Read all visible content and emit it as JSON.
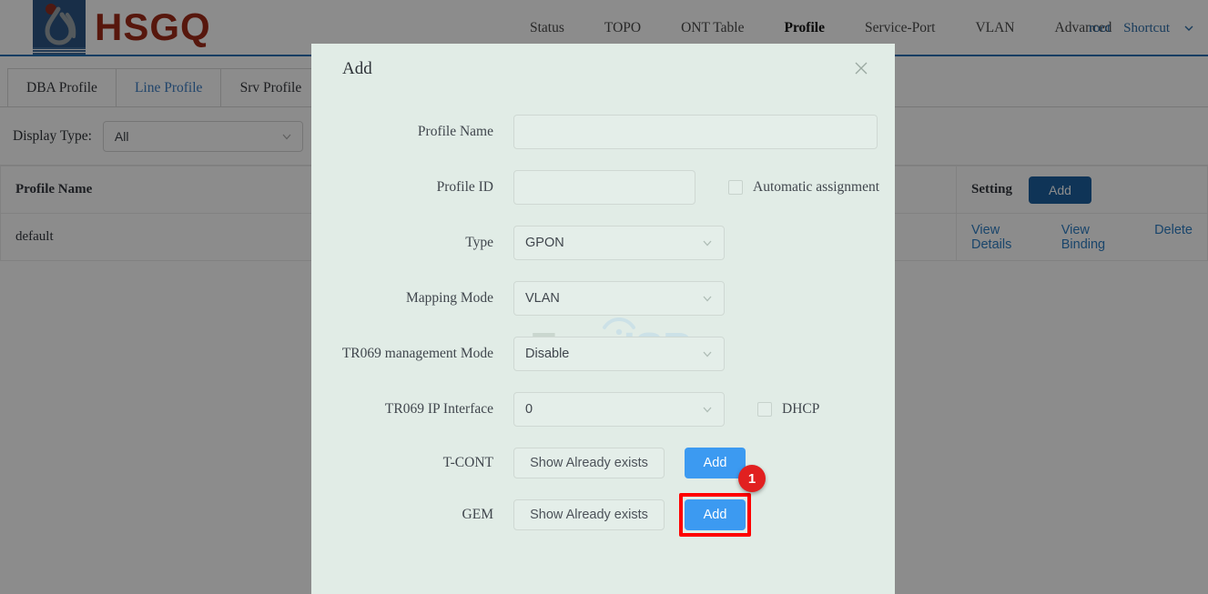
{
  "brand": {
    "name": "HSGQ",
    "logo_icon": "hsgq-flame-logo"
  },
  "nav": {
    "items": [
      {
        "label": "Status",
        "active": false
      },
      {
        "label": "TOPO",
        "active": false
      },
      {
        "label": "ONT Table",
        "active": false
      },
      {
        "label": "Profile",
        "active": true
      },
      {
        "label": "Service-Port",
        "active": false
      },
      {
        "label": "VLAN",
        "active": false
      },
      {
        "label": "Advanced",
        "active": false
      }
    ],
    "user": "root",
    "shortcut": "Shortcut"
  },
  "tabs": [
    {
      "label": "DBA Profile",
      "active": false
    },
    {
      "label": "Line Profile",
      "active": true
    },
    {
      "label": "Srv Profile",
      "active": false
    }
  ],
  "filter": {
    "label": "Display Type:",
    "value": "All"
  },
  "table": {
    "columns": [
      {
        "label": "Profile Name"
      },
      {
        "label": "Setting"
      }
    ],
    "add_button": "Add",
    "rows": [
      {
        "profile_name": "default",
        "actions": [
          "View Details",
          "View Binding",
          "Delete"
        ]
      }
    ]
  },
  "modal": {
    "title": "Add",
    "close_icon": "close-icon",
    "fields": {
      "profile_name": {
        "label": "Profile Name",
        "value": "",
        "placeholder": ""
      },
      "profile_id": {
        "label": "Profile ID",
        "value": "",
        "placeholder": ""
      },
      "automatic_assignment": {
        "label": "Automatic assignment",
        "checked": false
      },
      "type": {
        "label": "Type",
        "value": "GPON"
      },
      "mapping_mode": {
        "label": "Mapping Mode",
        "value": "VLAN"
      },
      "tr069_management_mode": {
        "label": "TR069 management Mode",
        "value": "Disable"
      },
      "tr069_ip_interface": {
        "label": "TR069 IP Interface",
        "value": "0"
      },
      "dhcp": {
        "label": "DHCP",
        "checked": false
      },
      "tcont": {
        "label": "T-CONT",
        "show_button": "Show Already exists",
        "add_button": "Add"
      },
      "gem": {
        "label": "GEM",
        "show_button": "Show Already exists",
        "add_button": "Add"
      }
    },
    "annotation": {
      "badge": "1"
    }
  },
  "watermark": {
    "part1": "Foro",
    "part2": "ISP"
  },
  "colors": {
    "brand_red": "#9e2a18",
    "logo_blue": "#2c5583",
    "link_blue": "#2f7ec4",
    "primary_button": "#1d5f9e",
    "accent_button": "#3c9af1",
    "annotation_red": "#ff0000",
    "badge_red": "#e12020",
    "modal_bg": "#e1ece6"
  }
}
